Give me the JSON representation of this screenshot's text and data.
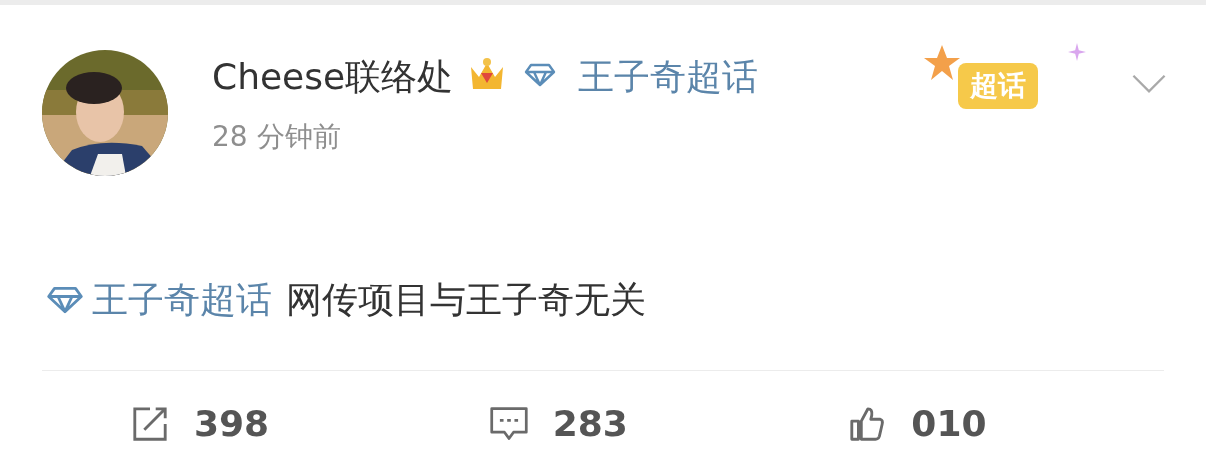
{
  "post": {
    "author": "Cheese联络处",
    "topic": "王子奇超话",
    "time": "28 分钟前",
    "badge": "超话",
    "body_topic": "王子奇超话",
    "body_text": "网传项目与王子奇无关"
  },
  "actions": [
    {
      "kind": "repost",
      "count": "398"
    },
    {
      "kind": "comment",
      "count": "283"
    },
    {
      "kind": "like",
      "count": "010"
    }
  ]
}
